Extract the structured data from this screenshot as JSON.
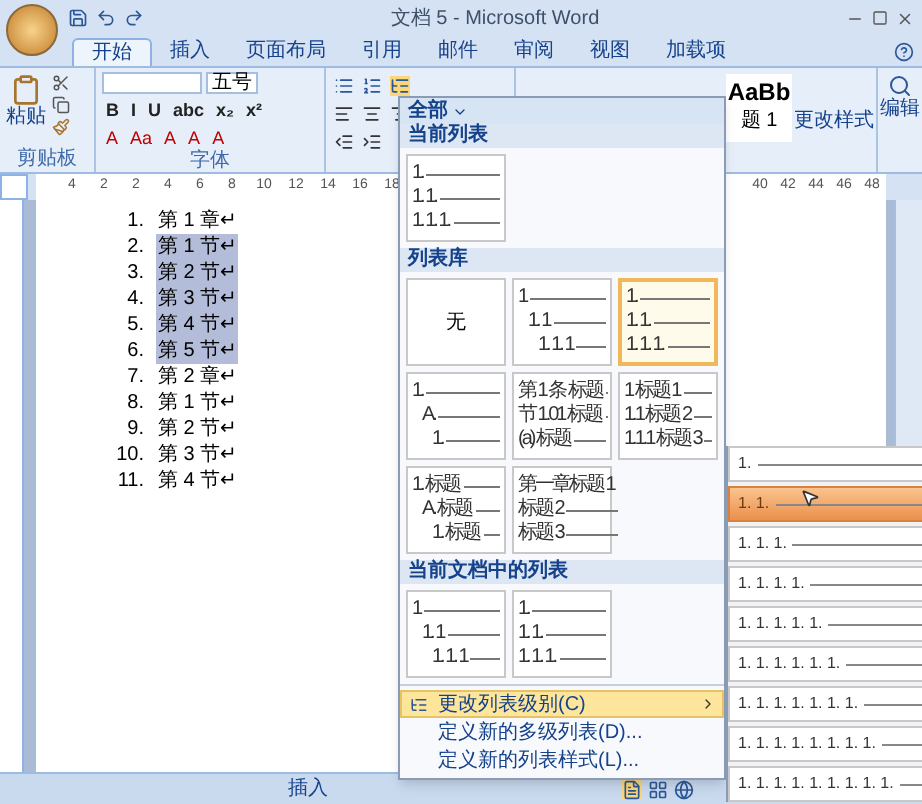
{
  "window": {
    "title": "文档 5 - Microsoft Word"
  },
  "ribbon_tabs": [
    {
      "label": "开始",
      "selected": true
    },
    {
      "label": "插入",
      "selected": false
    },
    {
      "label": "页面布局",
      "selected": false
    },
    {
      "label": "引用",
      "selected": false
    },
    {
      "label": "邮件",
      "selected": false
    },
    {
      "label": "审阅",
      "selected": false
    },
    {
      "label": "视图",
      "selected": false
    },
    {
      "label": "加载项",
      "selected": false
    }
  ],
  "ribbon": {
    "clipboard": {
      "paste_label": "粘贴",
      "group_label": "剪贴板"
    },
    "font": {
      "font_size": "五号",
      "format_buttons": [
        "B",
        "I",
        "U",
        "abc",
        "x₂",
        "x²"
      ],
      "effect_buttons": [
        "A",
        "Aa",
        "A",
        "A",
        "A"
      ],
      "group_label": "字体"
    },
    "styles": {
      "preview": "AaBb",
      "style_name": "题 1",
      "change_styles": "更改样式"
    },
    "editing": {
      "label": "编辑"
    }
  },
  "ruler": {
    "left_labels": [
      "4",
      "2",
      "2",
      "4",
      "6",
      "8",
      "10",
      "12",
      "14",
      "16",
      "18"
    ],
    "right_labels": [
      "40",
      "42",
      "44",
      "46",
      "48"
    ]
  },
  "document": {
    "items": [
      {
        "number": "1.",
        "text": "第 1 章↵",
        "selected": false
      },
      {
        "number": "2.",
        "text": "第 1 节↵",
        "selected": true
      },
      {
        "number": "3.",
        "text": "第 2 节↵",
        "selected": true
      },
      {
        "number": "4.",
        "text": "第 3 节↵",
        "selected": true
      },
      {
        "number": "5.",
        "text": "第 4 节↵",
        "selected": true
      },
      {
        "number": "6.",
        "text": "第 5 节↵",
        "selected": true
      },
      {
        "number": "7.",
        "text": "第 2 章↵",
        "selected": false
      },
      {
        "number": "8.",
        "text": "第 1 节↵",
        "selected": false
      },
      {
        "number": "9.",
        "text": "第 2 节↵",
        "selected": false
      },
      {
        "number": "10.",
        "text": "第 3 节↵",
        "selected": false
      },
      {
        "number": "11.",
        "text": "第 4 节↵",
        "selected": false
      }
    ]
  },
  "list_menu": {
    "filter": "全部",
    "current_list": {
      "heading": "当前列表",
      "thumbnails": [
        {
          "kind": "flat",
          "selected": false,
          "lines": [
            "1.",
            "1. 1.",
            "1. 1. 1."
          ]
        }
      ]
    },
    "library": {
      "heading": "列表库",
      "thumbnails": [
        {
          "kind": "none",
          "selected": false,
          "lines": [
            "无"
          ]
        },
        {
          "kind": "indented",
          "selected": false,
          "lines": [
            "1",
            "1. 1",
            "1. 1. 1"
          ]
        },
        {
          "kind": "flat",
          "selected": true,
          "lines": [
            "1.",
            "1. 1.",
            "1. 1. 1."
          ]
        },
        {
          "kind": "indented",
          "selected": false,
          "lines": [
            "1.",
            "A.",
            "1."
          ]
        },
        {
          "kind": "flat",
          "selected": false,
          "lines": [
            "第 1 条 标题",
            "节 1.01 标题",
            "(a) 标题"
          ]
        },
        {
          "kind": "flat",
          "selected": false,
          "lines": [
            "1 标题 1",
            "1.1 标题 2",
            "1.1.1 标题 3"
          ]
        },
        {
          "kind": "indented",
          "selected": false,
          "lines": [
            "1. 标题",
            "A. 标题",
            "1. 标题"
          ]
        },
        {
          "kind": "flat",
          "selected": false,
          "lines": [
            "第一章标题 1",
            "标题 2",
            "标题 3"
          ]
        }
      ]
    },
    "document_lists": {
      "heading": "当前文档中的列表",
      "thumbnails": [
        {
          "kind": "indented",
          "selected": false,
          "lines": [
            "1",
            "1. 1",
            "1. 1. 1"
          ]
        },
        {
          "kind": "flat",
          "selected": false,
          "lines": [
            "1.",
            "1. 1.",
            "1. 1. 1."
          ]
        }
      ]
    },
    "commands": [
      {
        "kind": "submenu",
        "label": "更改列表级别(C)",
        "selected": true
      },
      {
        "kind": "plain",
        "label": "定义新的多级列表(D)...",
        "selected": false
      },
      {
        "kind": "plain",
        "label": "定义新的列表样式(L)...",
        "selected": false
      }
    ]
  },
  "level_submenu": {
    "items": [
      {
        "label": "1.",
        "selected": false
      },
      {
        "label": "1. 1.",
        "selected": true
      },
      {
        "label": "1. 1. 1.",
        "selected": false
      },
      {
        "label": "1. 1. 1. 1.",
        "selected": false
      },
      {
        "label": "1. 1. 1. 1. 1.",
        "selected": false
      },
      {
        "label": "1. 1. 1. 1. 1. 1.",
        "selected": false
      },
      {
        "label": "1. 1. 1. 1. 1. 1. 1.",
        "selected": false
      },
      {
        "label": "1. 1. 1. 1. 1. 1. 1. 1.",
        "selected": false
      },
      {
        "label": "1. 1. 1. 1. 1. 1. 1. 1. 1.",
        "selected": false
      }
    ]
  },
  "status_bar": {
    "mode": "插入"
  }
}
